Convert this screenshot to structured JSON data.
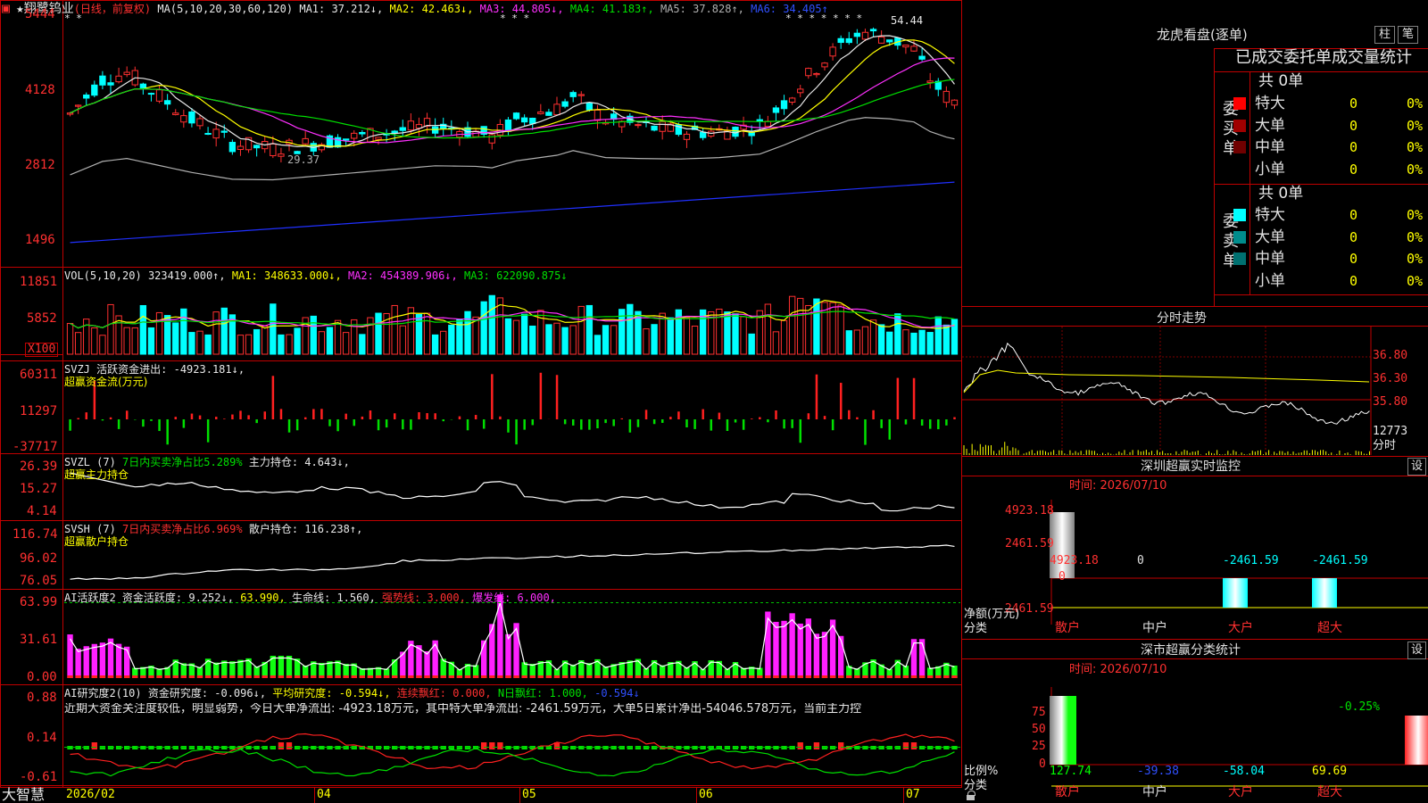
{
  "price": {
    "title_stock": "★翔鹭钨业",
    "title_mode": "(日线，前复权)",
    "ma_label": "MA(5,10,20,30,60,120)",
    "ma1": "MA1: 37.212↓,",
    "ma2": "MA2: 42.463↓,",
    "ma3": "MA3: 44.805↓,",
    "ma4": "MA4: 41.183↑,",
    "ma5": "MA5: 37.828↑,",
    "ma6": "MA6: 34.405↑",
    "axis": [
      "5444",
      "4128",
      "2812",
      "1496"
    ],
    "high_mark": "54.44",
    "low_mark": "29.37",
    "star_mark": "* *",
    "star_mark2": "* * *",
    "star_mark3": "* * * * * * *"
  },
  "vol": {
    "label": "VOL(5,10,20)",
    "value": "323419.000↑,",
    "ma1": "MA1: 348633.000↓,",
    "ma2": "MA2: 454389.906↓,",
    "ma3": "MA3: 622090.875↓",
    "axis": [
      "11851",
      "5852"
    ],
    "unit": "X100"
  },
  "svzj": {
    "label": "SVZJ",
    "value": "活跃资金进出: -4923.181↓,",
    "sub": "超赢资金流(万元)",
    "axis": [
      "60311",
      "11297",
      "-37717"
    ]
  },
  "svzl": {
    "label": "SVZL (7)",
    "ratio": "7日内买卖净占比5.289%",
    "hold": "主力持仓: 4.643↓,",
    "sub": "超赢主力持仓",
    "axis": [
      "26.39",
      "15.27",
      "4.14"
    ]
  },
  "svsh": {
    "label": "SVSH (7)",
    "ratio": "7日内买卖净占比6.969%",
    "hold": "散户持仓: 116.238↑,",
    "sub": "超赢散户持仓",
    "axis": [
      "116.74",
      "96.02",
      "76.05"
    ]
  },
  "ai1": {
    "label": "AI活跃度2",
    "v1": "资金活跃度: 9.252↓,",
    "v2": "63.990,",
    "v3": "生命线: 1.560,",
    "v4": "强势线: 3.000,",
    "v5": "爆发线: 6.000,",
    "axis": [
      "63.99",
      "31.61",
      "0.00"
    ]
  },
  "ai2": {
    "label": "AI研究度2(10)",
    "v1": "资金研究度: -0.096↓,",
    "v2": "平均研究度: -0.594↓,",
    "v3": "连续飘红: 0.000,",
    "v4": "N日飘红: 1.000,",
    "v5": "-0.594↓",
    "comment": "近期大资金关注度较低，明显弱势，今日大单净流出: -4923.18万元，其中特大单净流出: -2461.59万元，大单5日累计净出-54046.578万元，当前主力控",
    "axis": [
      "0.88",
      "0.14",
      "-0.61"
    ]
  },
  "dates": [
    "2026/02",
    "04",
    "05",
    "06",
    "07"
  ],
  "app_name": "大智慧",
  "right": {
    "lhb_title": "龙虎看盘(逐单)",
    "btn_zhu": "柱",
    "btn_bi": "笔",
    "header": "已成交委托单成交量统计",
    "buy_side": "委买单",
    "sell_side": "委卖单",
    "buy_total": "共 0单",
    "sell_total": "共 0单",
    "rows_buy": [
      {
        "name": "特大",
        "vol": "0",
        "pct": "0%",
        "color": "#ff0000"
      },
      {
        "name": "大单",
        "vol": "0",
        "pct": "0%",
        "color": "#a00000"
      },
      {
        "name": "中单",
        "vol": "0",
        "pct": "0%",
        "color": "#700000"
      },
      {
        "name": "小单",
        "vol": "0",
        "pct": "0%",
        "color": ""
      }
    ],
    "rows_sell": [
      {
        "name": "特大",
        "vol": "0",
        "pct": "0%",
        "color": "#00ffff"
      },
      {
        "name": "大单",
        "vol": "0",
        "pct": "0%",
        "color": "#008c8c"
      },
      {
        "name": "中单",
        "vol": "0",
        "pct": "0%",
        "color": "#007070"
      },
      {
        "name": "小单",
        "vol": "0",
        "pct": "0%",
        "color": ""
      }
    ],
    "fs_title": "分时走势",
    "fs_axis": [
      "36.80",
      "36.30",
      "35.80",
      "12773"
    ],
    "fs_unit": "分时",
    "mon_title": "深圳超赢实时监控",
    "mon_btn": "设",
    "mon_time": "时间: 2026/07/10",
    "mon_axis": [
      "4923.18",
      "2461.59",
      "0",
      "-2461.59"
    ],
    "mon_unit1": "净额(万元)",
    "mon_unit2": "分类",
    "mon_vals": [
      "4923.18",
      "0",
      "-2461.59",
      "-2461.59"
    ],
    "mon_cats": [
      "散户",
      "中户",
      "大户",
      "超大"
    ],
    "cls_title": "深市超赢分类统计",
    "cls_btn": "设",
    "cls_time": "时间: 2026/07/10",
    "cls_axis": [
      "75",
      "50",
      "25",
      "0"
    ],
    "cls_top": "-0.25%",
    "cls_unit1": "比例%",
    "cls_unit2": "分类",
    "cls_vals": [
      "127.74",
      "-39.38",
      "-58.04",
      "69.69"
    ],
    "cls_cats": [
      "散户",
      "中户",
      "大户",
      "超大"
    ]
  }
}
